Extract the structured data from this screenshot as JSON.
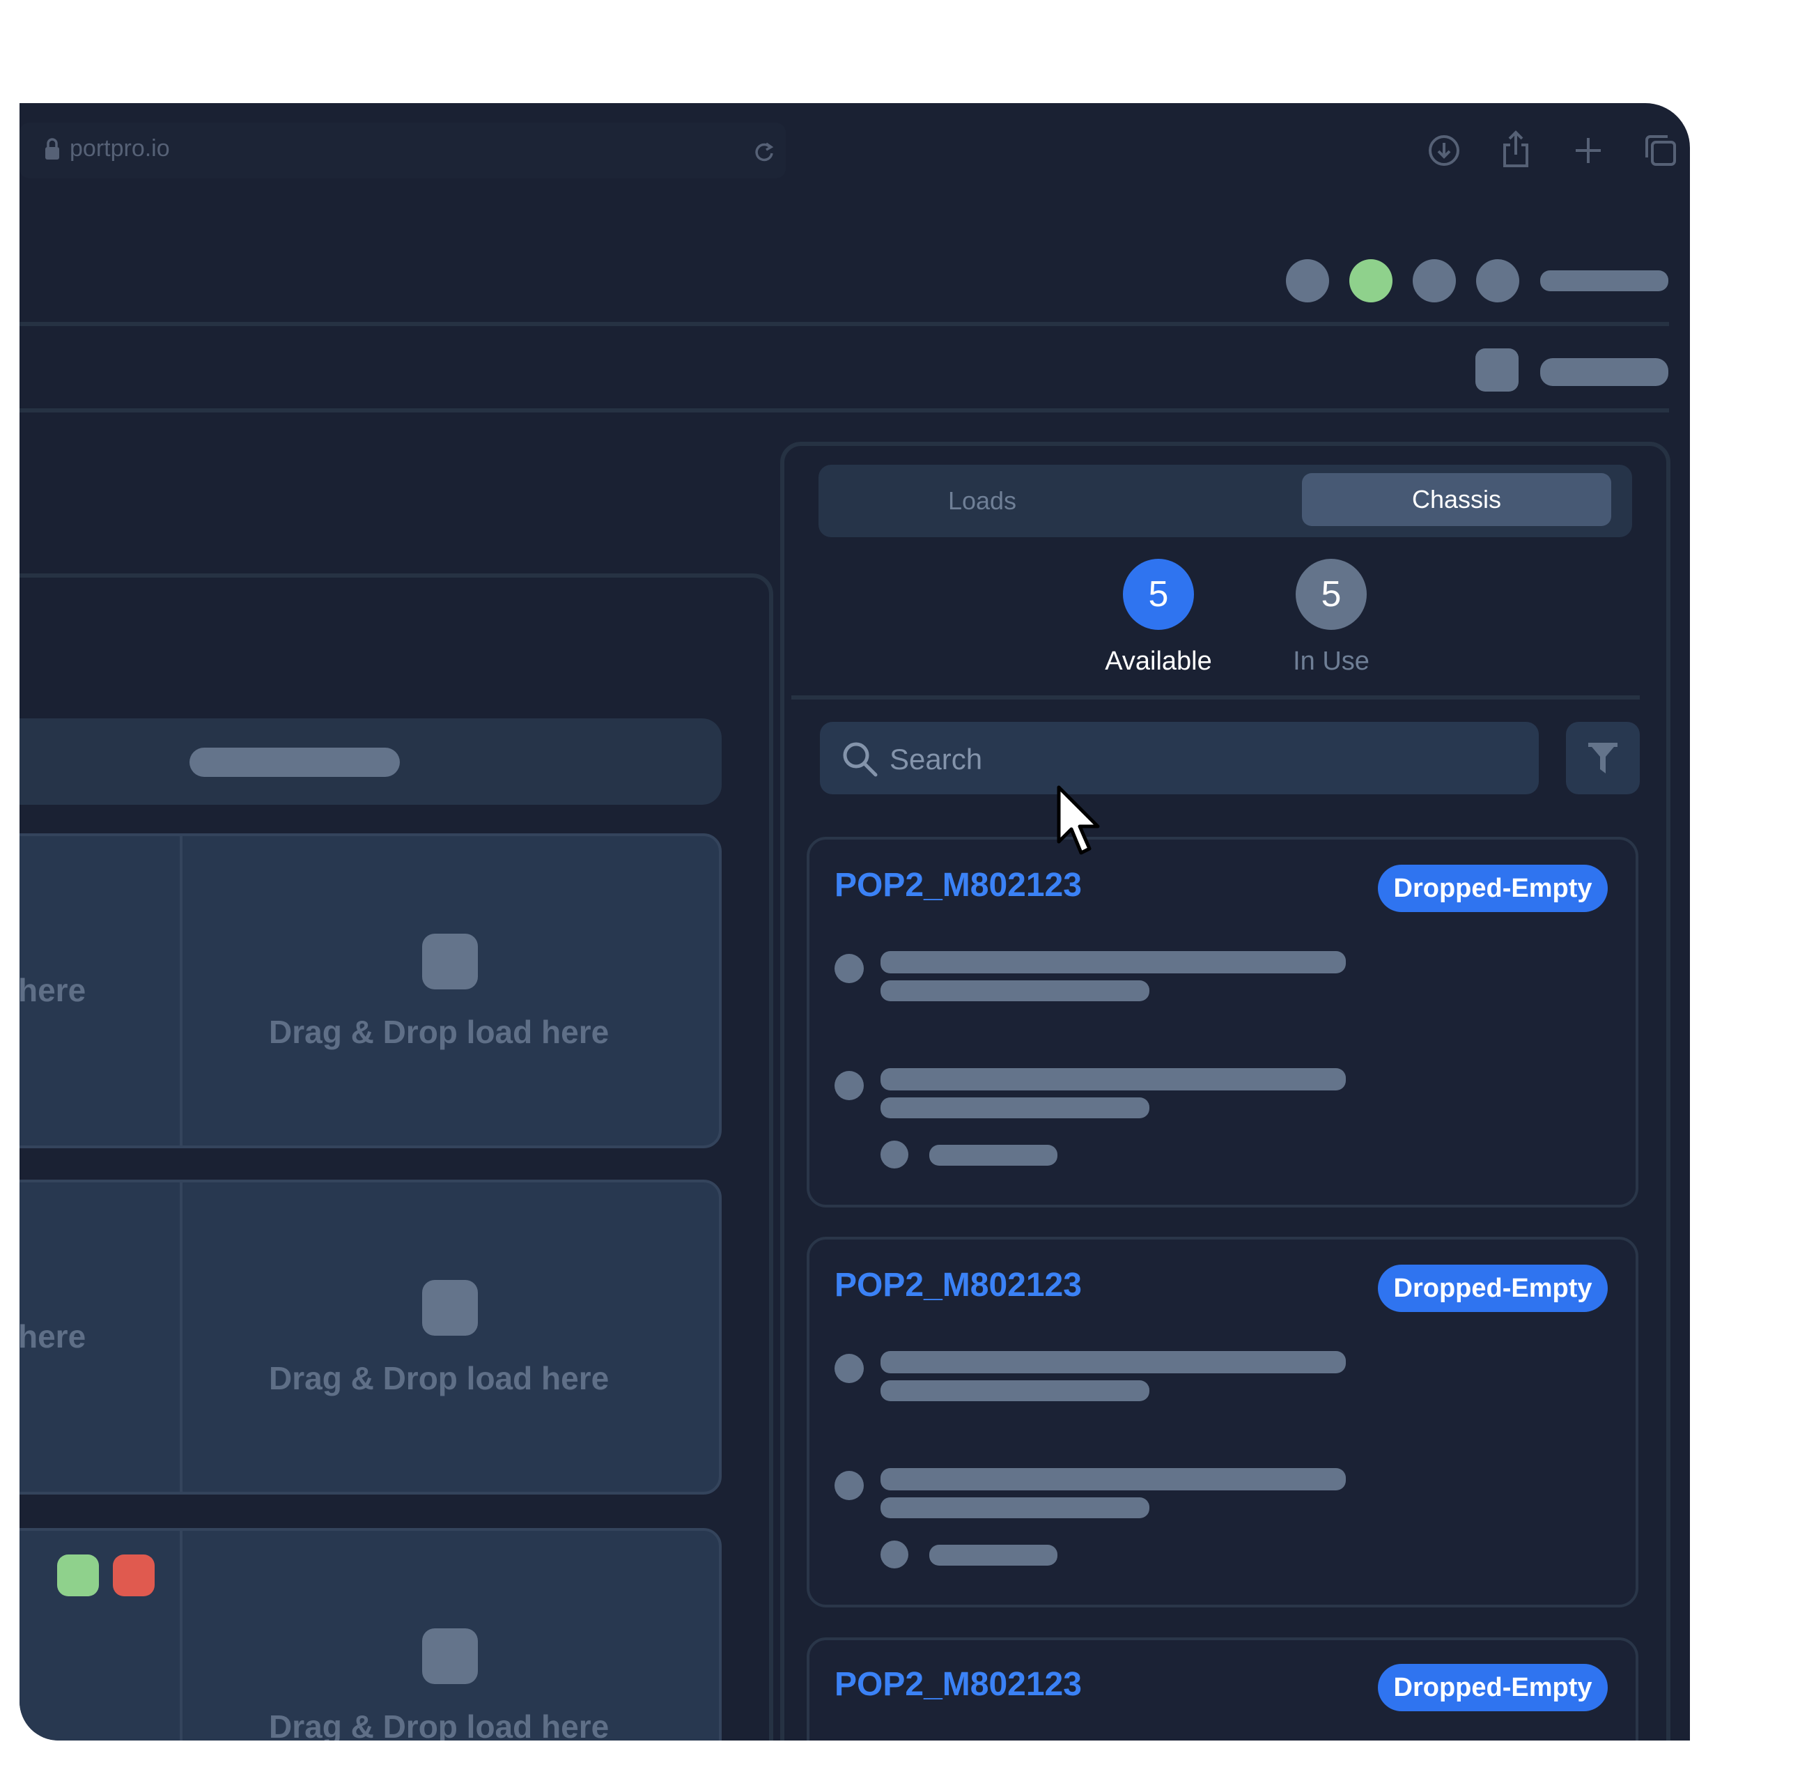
{
  "browser": {
    "url": "portpro.io",
    "toolbar_icons": [
      "download-icon",
      "share-icon",
      "plus-icon",
      "tabs-icon"
    ]
  },
  "header": {
    "status_dot_colors": [
      "#64748b",
      "#8fd18c",
      "#64748b",
      "#64748b"
    ]
  },
  "tabs": [
    {
      "label": "Loads",
      "active": false
    },
    {
      "label": "Chassis",
      "active": true
    }
  ],
  "counters": [
    {
      "count": "5",
      "label": "Available",
      "color": "#2f74f0",
      "active": true
    },
    {
      "count": "5",
      "label": "In Use",
      "color": "#64748b",
      "active": false
    }
  ],
  "search": {
    "placeholder": "Search"
  },
  "chassis_list": [
    {
      "id": "POP2_M802123",
      "status": "Dropped-Empty"
    },
    {
      "id": "POP2_M802123",
      "status": "Dropped-Empty"
    },
    {
      "id": "POP2_M802123",
      "status": "Dropped-Empty"
    }
  ],
  "dropzones": [
    {
      "left_text": "here",
      "right_text": "Drag & Drop load here"
    },
    {
      "left_text": "here",
      "right_text": "Drag & Drop load here"
    },
    {
      "left_text": "",
      "right_text": "Drag & Drop load here"
    }
  ],
  "indicator_colors": [
    "#8fd18c",
    "#e05a4f"
  ]
}
